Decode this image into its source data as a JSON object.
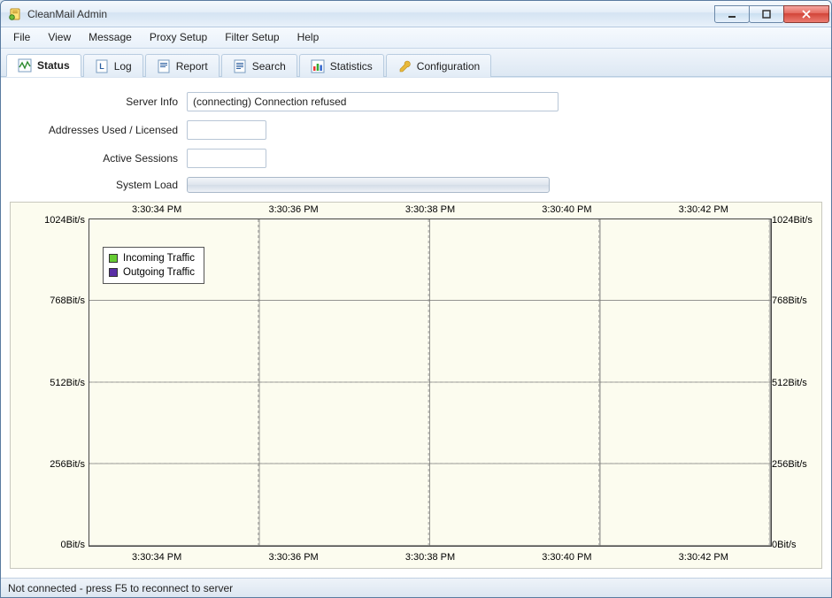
{
  "app": {
    "title": "CleanMail Admin"
  },
  "menu": {
    "file": "File",
    "view": "View",
    "message": "Message",
    "proxy_setup": "Proxy Setup",
    "filter_setup": "Filter Setup",
    "help": "Help"
  },
  "tabs": {
    "status": "Status",
    "log": "Log",
    "report": "Report",
    "search": "Search",
    "statistics": "Statistics",
    "configuration": "Configuration"
  },
  "form": {
    "server_info_label": "Server Info",
    "server_info_value": "(connecting) Connection refused",
    "addresses_label": "Addresses Used / Licensed",
    "addresses_value": "",
    "sessions_label": "Active Sessions",
    "sessions_value": "",
    "system_load_label": "System Load"
  },
  "chart_data": {
    "type": "line",
    "x_ticks": [
      "3:30:34 PM",
      "3:30:36 PM",
      "3:30:38 PM",
      "3:30:40 PM",
      "3:30:42 PM"
    ],
    "y_ticks": [
      "0Bit/s",
      "256Bit/s",
      "512Bit/s",
      "768Bit/s",
      "1024Bit/s"
    ],
    "ylim": [
      0,
      1024
    ],
    "series": [
      {
        "name": "Incoming Traffic",
        "color": "#66cc33",
        "values": [
          0,
          0,
          0,
          0,
          0
        ]
      },
      {
        "name": "Outgoing Traffic",
        "color": "#5a2ea6",
        "values": [
          0,
          0,
          0,
          0,
          0
        ]
      }
    ],
    "xlabel": "",
    "ylabel": "",
    "title": ""
  },
  "legend": {
    "incoming": "Incoming Traffic",
    "outgoing": "Outgoing Traffic",
    "incoming_color": "#66cc33",
    "outgoing_color": "#5a2ea6"
  },
  "status_bar": "Not connected - press F5 to reconnect to server"
}
